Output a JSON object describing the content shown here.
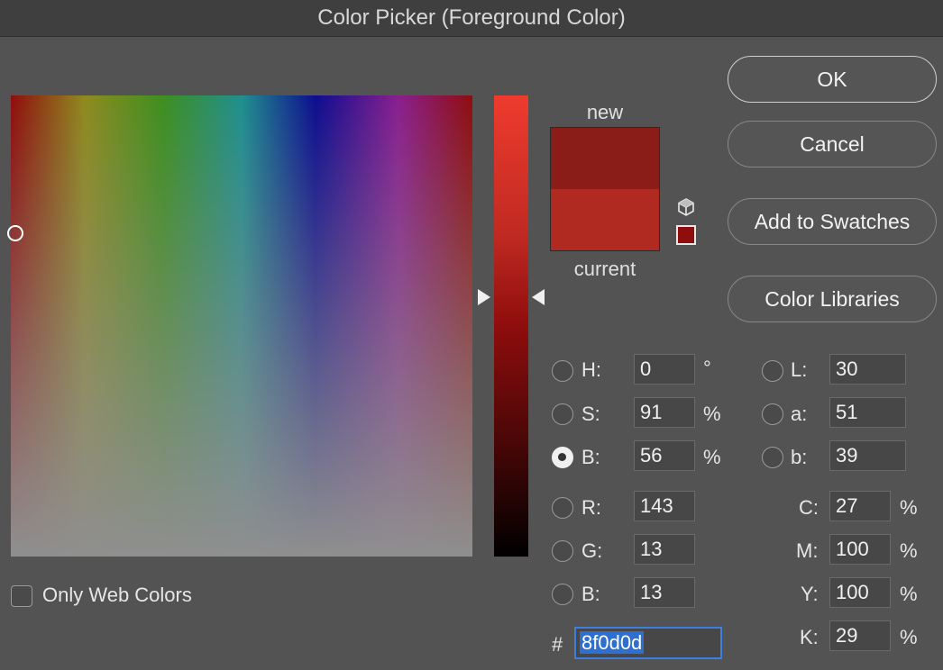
{
  "window": {
    "title": "Color Picker (Foreground Color)"
  },
  "preview": {
    "new_label": "new",
    "current_label": "current",
    "new_color": "#8a1d18",
    "current_color": "#b12a22",
    "web_safe_color": "#8f0d0d",
    "gamut_icon": "cube-icon"
  },
  "buttons": {
    "ok": "OK",
    "cancel": "Cancel",
    "add_to_swatches": "Add to Swatches",
    "color_libraries": "Color Libraries"
  },
  "hsb": {
    "h": {
      "label": "H:",
      "value": "0",
      "unit": "°"
    },
    "s": {
      "label": "S:",
      "value": "91",
      "unit": "%"
    },
    "b": {
      "label": "B:",
      "value": "56",
      "unit": "%"
    }
  },
  "rgb": {
    "r": {
      "label": "R:",
      "value": "143"
    },
    "g": {
      "label": "G:",
      "value": "13"
    },
    "b": {
      "label": "B:",
      "value": "13"
    }
  },
  "lab": {
    "l": {
      "label": "L:",
      "value": "30"
    },
    "a": {
      "label": "a:",
      "value": "51"
    },
    "b": {
      "label": "b:",
      "value": "39"
    }
  },
  "cmyk": {
    "c": {
      "label": "C:",
      "value": "27",
      "unit": "%"
    },
    "m": {
      "label": "M:",
      "value": "100",
      "unit": "%"
    },
    "y": {
      "label": "Y:",
      "value": "100",
      "unit": "%"
    },
    "k": {
      "label": "K:",
      "value": "29",
      "unit": "%"
    }
  },
  "hex": {
    "label": "#",
    "value": "8f0d0d"
  },
  "only_web_colors": {
    "label": "Only Web Colors",
    "checked": false
  },
  "selected_mode": "B"
}
